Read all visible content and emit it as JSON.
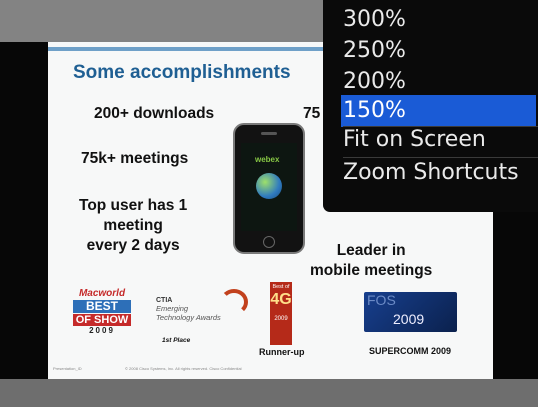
{
  "slide": {
    "title": "Some accomplishments",
    "downloads": "200+ downloads",
    "partial_right": "75",
    "meetings": "75k+ meetings",
    "top_user_line1": "Top user has 1",
    "top_user_line2": "meeting",
    "top_user_line3": "every 2 days",
    "leader_line1": "Leader in",
    "leader_line2": "mobile meetings",
    "phone_app": "webex",
    "macworld": {
      "line1": "Macworld",
      "line2": "BEST",
      "line3": "OF SHOW",
      "line4": "2009"
    },
    "ctia": {
      "line1": "CTIA",
      "line2": "Emerging",
      "line3": "Technology Awards",
      "line4": "1st Place"
    },
    "best4g": {
      "line1": "Best of",
      "line2": "4G",
      "line3": "2009"
    },
    "runner_up": "Runner-up",
    "fos": {
      "line1": "FOS",
      "line2": "2009"
    },
    "supercomm": "SUPERCOMM 2009",
    "footer_left": "Presentation_ID",
    "footer_mid": "© 2008 Cisco Systems, Inc. All rights reserved.     Cisco Confidential"
  },
  "zoom_menu": {
    "items": [
      {
        "label": "300%",
        "selected": false
      },
      {
        "label": "250%",
        "selected": false
      },
      {
        "label": "200%",
        "selected": false
      },
      {
        "label": "150%",
        "selected": true
      },
      {
        "label": "Fit on Screen",
        "selected": false
      },
      {
        "label": "Zoom Shortcuts",
        "selected": false
      }
    ]
  },
  "colors": {
    "title": "#1f5f93",
    "menu_selected": "#1a5bd6",
    "menu_background": "#0a0a0a"
  }
}
